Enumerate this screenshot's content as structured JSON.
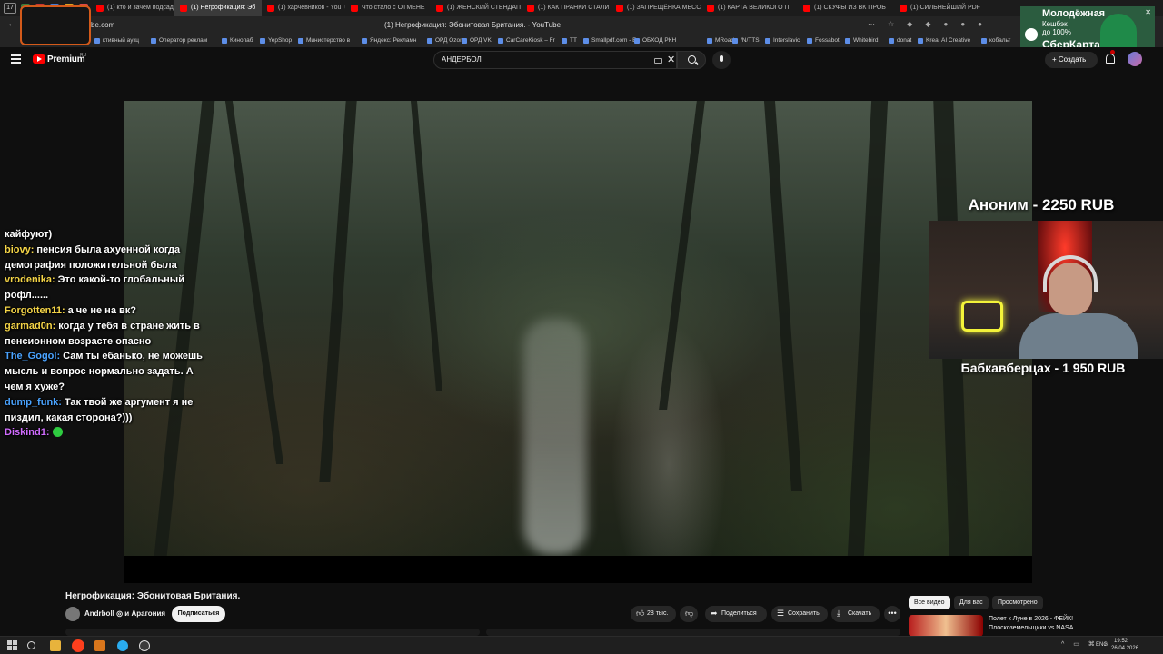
{
  "browser": {
    "tab_count": "17",
    "tabs": [
      {
        "label": "(1) кто и зачем подсади",
        "active": false
      },
      {
        "label": "(1) Негрофикация: Эб",
        "active": true
      },
      {
        "label": "(1) харчевников - YouTub",
        "active": false
      },
      {
        "label": "Что стало с ОТМЕНЕ",
        "active": false
      },
      {
        "label": "(1) ЖЕНСКИЙ СТЕНДАП",
        "active": false
      },
      {
        "label": "(1) КАК ПРАНКИ СТАЛИ",
        "active": false
      },
      {
        "label": "(1) ЗАПРЕЩЁНКА МЕСС",
        "active": false
      },
      {
        "label": "(1) КАРТА ВЕЛИКОГО П",
        "active": false
      },
      {
        "label": "(1) СКУФЫ ИЗ ВК ПРОБ",
        "active": false
      },
      {
        "label": "(1) СИЛЬНЕЙШИЙ PDF",
        "active": false
      }
    ],
    "url": "be.com",
    "page_title": "(1) Негрофикация: Эбонитовая Британия. - YouTube",
    "bookmarks": [
      "ктивный аукц",
      "Оператор реклам",
      "Кинопаб",
      "YepShop",
      "Министерство в",
      "Яндекс: Рекламн",
      "ОРД Ozon",
      "ОРД VK",
      "CarCareKiosk – Fr",
      "TT",
      "Smallpdf.com - Бе",
      "ОБХОД РКН",
      "MRoad",
      "/N/TTS",
      "Interslavic",
      "Fossabot",
      "Whitebird",
      "donat",
      "Krea: AI Creative",
      "кобальт"
    ]
  },
  "ad": {
    "line1": "Молодёжная",
    "line2a": "Кешбэк",
    "line2b": "до 100%",
    "line3": "СберКарта"
  },
  "youtube": {
    "logo_text": "Premium",
    "logo_region": "RU",
    "search_value": "АНДЕРБОЛ",
    "create_label": "Создать"
  },
  "chat": [
    {
      "user": "",
      "color": "#ffffff",
      "text": "кайфуют)"
    },
    {
      "user": "biovy",
      "color": "#f5d547",
      "text": "пенсия была ахуенной когда демография положительной была"
    },
    {
      "user": "vrodenika",
      "color": "#f5d547",
      "text": "Это какой-то глобальный рофл......"
    },
    {
      "user": "Forgotten11",
      "color": "#f5d547",
      "text": "а че не на вк?"
    },
    {
      "user": "garmad0n",
      "color": "#f5d547",
      "text": "когда у тебя в стране жить в пенсионном возрасте опасно"
    },
    {
      "user": "The_Gogol",
      "color": "#4aa3ff",
      "text": "Сам ты ебанько, не можешь мысль и вопрос нормально задать. А чем я хуже?"
    },
    {
      "user": "dump_funk",
      "color": "#4aa3ff",
      "text": "Так твой же аргумент я не пиздил, какая сторона?)))"
    },
    {
      "user": "Diskind1",
      "color": "#d16cff",
      "text": ""
    }
  ],
  "donations": {
    "top": "Аноним - 2250 RUB",
    "bottom": "Бабкавберцах - 1 950 RUB"
  },
  "video": {
    "title": "Негрофикация: Эбонитовая Британия.",
    "channel": "Andrboll ◎ и Арагония",
    "subscribe_label": "Подписаться",
    "likes": "28 тыс.",
    "share_label": "Поделиться",
    "save_label": "Сохранить",
    "download_label": "Скачать",
    "more_label": "•••"
  },
  "recommendations": {
    "chips": [
      {
        "label": "Все видео",
        "active": true
      },
      {
        "label": "Для вас",
        "active": false
      },
      {
        "label": "Просмотрено",
        "active": false
      }
    ],
    "first_title": "Полет к Луне в 2026 - ФЕЙК! Плоскоземельщики vs NASA"
  },
  "taskbar": {
    "tray_icons": "^ ▭ ⌘ ♪",
    "lang": "ENG",
    "time": "19:52",
    "date": "26.04.2026"
  },
  "colors": {
    "youtube_red": "#ff0000",
    "background": "#0f0f0f",
    "chat_yellow": "#f5d547",
    "chat_blue": "#4aa3ff",
    "chat_purple": "#d16cff",
    "cam_border": "#d45a1a"
  }
}
